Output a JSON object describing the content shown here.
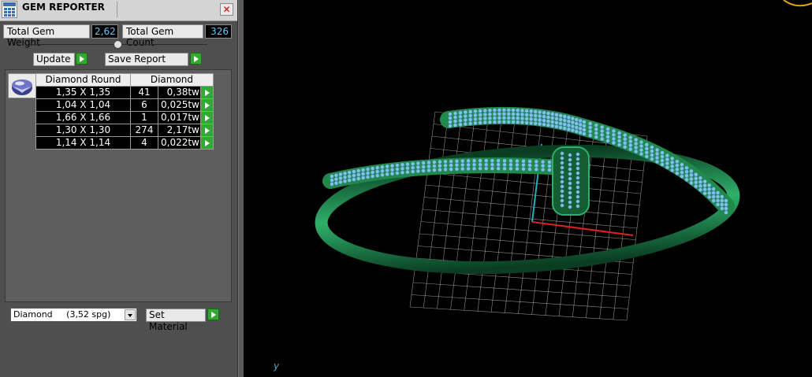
{
  "window": {
    "title": "GEM REPORTER",
    "close_symbol": "✕"
  },
  "stats": {
    "total_weight_label": "Total Gem Weight",
    "total_weight_value": "2,62",
    "total_count_label": "Total Gem Count",
    "total_count_value": "326"
  },
  "buttons": {
    "update": "Update",
    "save_report": "Save Report",
    "set_material": "Set Material"
  },
  "gem_table": {
    "headers": [
      "Diamond Round",
      "Diamond"
    ],
    "rows": [
      {
        "size": "1,35 X 1,35",
        "count": "41",
        "weight": "0,38tw"
      },
      {
        "size": "1,04 X 1,04",
        "count": "6",
        "weight": "0,025tw"
      },
      {
        "size": "1,66 X 1,66",
        "count": "1",
        "weight": "0,017tw"
      },
      {
        "size": "1,30 X 1,30",
        "count": "274",
        "weight": "2,17tw"
      },
      {
        "size": "1,14 X 1,14",
        "count": "4",
        "weight": "0,022tw"
      }
    ]
  },
  "material_select": {
    "selected": "Diamond     (3,52 spg)"
  },
  "viewport": {
    "axis_label": "y",
    "ring_color": "#1f8a4a",
    "gem_color": "#7fc2e6",
    "grid_color": "#ffffff",
    "x_axis_color": "#e02020",
    "y_axis_color": "#20b0c0"
  }
}
